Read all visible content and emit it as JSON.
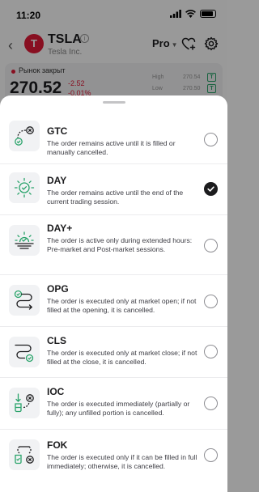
{
  "status_bar": {
    "time": "11:20"
  },
  "header": {
    "ticker_logo_letter": "T",
    "ticker": "TSLA",
    "company": "Tesla Inc.",
    "mode": "Pro",
    "info_icon": "i",
    "back_icon": "chevron-left-icon"
  },
  "quote": {
    "market_status": "Рынок закрыт",
    "price": "270.52",
    "change_abs": "-2.52",
    "change_pct": "-0.01%",
    "high_label": "High",
    "high_value": "270.54",
    "high_badge": "T",
    "low_label": "Low",
    "low_value": "270.50",
    "low_badge": "T"
  },
  "colors": {
    "accent_green": "#29a36a",
    "negative_red": "#e31937",
    "checked_radio": "#1c1c1e"
  },
  "sheet": {
    "options": [
      {
        "code": "GTC",
        "icon": "gtc-icon",
        "description": "The order remains active until it is filled or manually cancelled.",
        "selected": false
      },
      {
        "code": "DAY",
        "icon": "day-sun-icon",
        "description": "The order remains active until the end of the current trading session.",
        "selected": true
      },
      {
        "code": "DAY+",
        "icon": "day-plus-sunrise-icon",
        "description": "The order is active only during extended hours: Pre-market and Post-market sessions.",
        "selected": false
      },
      {
        "code": "OPG",
        "icon": "opg-route-icon",
        "description": "The order is executed only at market open; if not filled at the opening, it is cancelled.",
        "selected": false
      },
      {
        "code": "CLS",
        "icon": "cls-route-icon",
        "description": "The order is executed only at market close; if not filled at the close, it is cancelled.",
        "selected": false
      },
      {
        "code": "IOC",
        "icon": "ioc-icon",
        "description": "The order is executed immediately (partially or fully); any unfilled portion is cancelled.",
        "selected": false
      },
      {
        "code": "FOK",
        "icon": "fok-icon",
        "description": "The order is executed only if it can be filled in full immediately; otherwise, it is cancelled.",
        "selected": false
      }
    ]
  }
}
